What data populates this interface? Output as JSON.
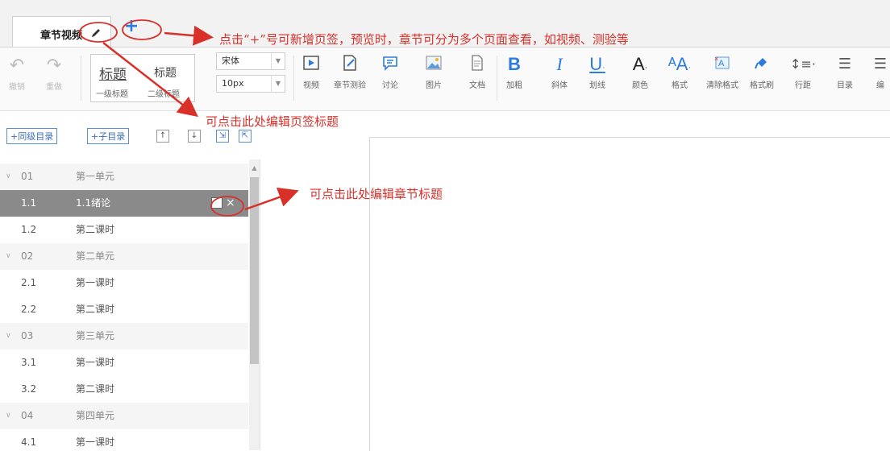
{
  "tab": {
    "label": "章节视频"
  },
  "toolbar": {
    "undo": "撤销",
    "redo": "重做",
    "heading1": "标题",
    "heading2": "标题",
    "heading1_sub": "一级标题",
    "heading2_sub": "二级标题",
    "font_family": "宋体",
    "font_size": "10px",
    "video": "视频",
    "chapter_quiz": "章节测验",
    "discussion": "讨论",
    "image": "图片",
    "document": "文档",
    "bold": "加粗",
    "italic": "斜体",
    "underline": "划线",
    "color": "颜色",
    "format": "格式",
    "clear_format": "清除格式",
    "format_painter": "格式刷",
    "line_spacing": "行距",
    "toc": "目录",
    "edit": "编"
  },
  "controls": {
    "same_level": "+同级目录",
    "sub_level": "+子目录"
  },
  "tree": [
    {
      "num": "01",
      "name": "第一单元",
      "type": "unit"
    },
    {
      "num": "1.1",
      "name": "1.1绪论",
      "type": "selected"
    },
    {
      "num": "1.2",
      "name": "第二课时",
      "type": "item"
    },
    {
      "num": "02",
      "name": "第二单元",
      "type": "unit"
    },
    {
      "num": "2.1",
      "name": "第一课时",
      "type": "item"
    },
    {
      "num": "2.2",
      "name": "第二课时",
      "type": "item"
    },
    {
      "num": "03",
      "name": "第三单元",
      "type": "unit"
    },
    {
      "num": "3.1",
      "name": "第一课时",
      "type": "item"
    },
    {
      "num": "3.2",
      "name": "第二课时",
      "type": "item"
    },
    {
      "num": "04",
      "name": "第四单元",
      "type": "unit"
    },
    {
      "num": "4.1",
      "name": "第一课时",
      "type": "item"
    }
  ],
  "annotations": {
    "add_tab": "点击“+”号可新增页签，预览时，章节可分为多个页面查看，如视频、测验等",
    "edit_tab": "可点击此处编辑页签标题",
    "edit_chapter": "可点击此处编辑章节标题"
  },
  "colors": {
    "annotation": "#d9302a",
    "accent": "#2e7be0",
    "selected_row": "#8a8a8a"
  }
}
